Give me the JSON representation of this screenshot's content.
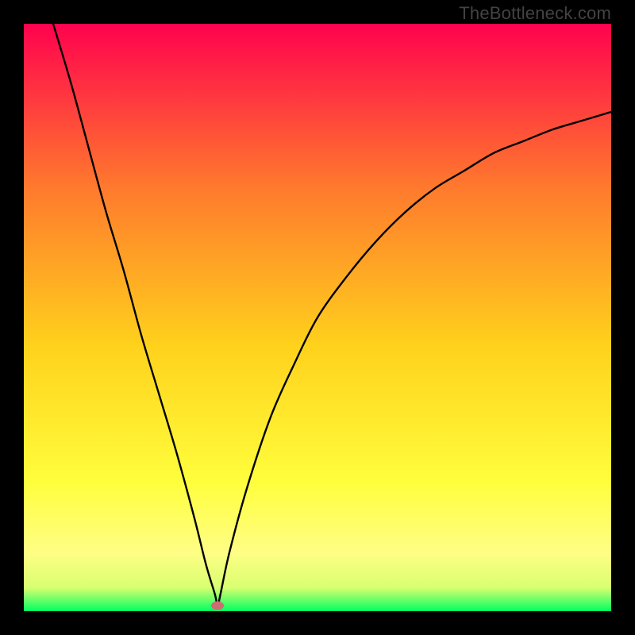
{
  "watermark": "TheBottleneck.com",
  "chart_data": {
    "type": "line",
    "title": "",
    "xlabel": "",
    "ylabel": "",
    "xlim": [
      0,
      100
    ],
    "ylim": [
      0,
      100
    ],
    "grid": false,
    "legend": false,
    "background_gradient": {
      "top": "#ff024e",
      "upper_mid": "#ff7a2d",
      "mid": "#ffd21c",
      "lower_mid": "#fffe3c",
      "band": "#fffe85",
      "bottom": "#00ff61"
    },
    "minimum_marker": {
      "x": 33,
      "y": 1,
      "color": "#cc6d73"
    },
    "series": [
      {
        "name": "bottleneck-curve",
        "color": "#000000",
        "x": [
          5,
          8,
          11,
          14,
          17,
          20,
          23,
          26,
          29,
          31,
          32.5,
          33,
          33.5,
          35,
          38,
          42,
          46,
          50,
          55,
          60,
          65,
          70,
          75,
          80,
          85,
          90,
          95,
          100
        ],
        "y": [
          100,
          90,
          79,
          68,
          58,
          47,
          37,
          27,
          16,
          8,
          3,
          1,
          3,
          10,
          21,
          33,
          42,
          50,
          57,
          63,
          68,
          72,
          75,
          78,
          80,
          82,
          83.5,
          85
        ]
      }
    ]
  }
}
